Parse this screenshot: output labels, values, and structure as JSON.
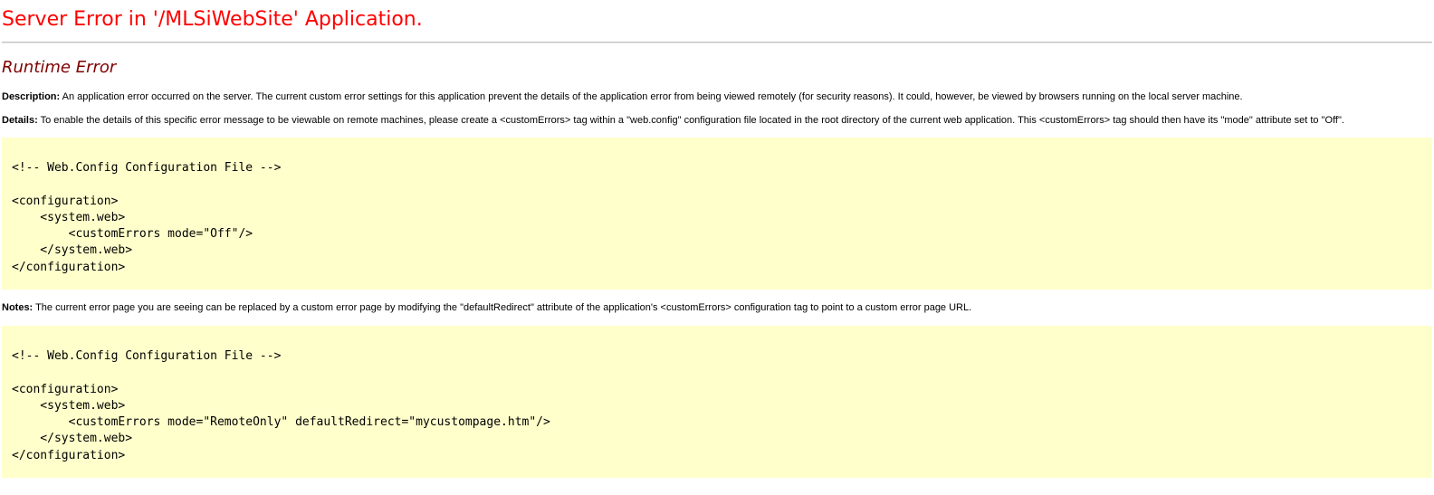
{
  "title": "Server Error in '/MLSiWebSite' Application.",
  "subtitle": "Runtime Error",
  "description": {
    "label": "Description:",
    "text": " An application error occurred on the server. The current custom error settings for this application prevent the details of the application error from being viewed remotely (for security reasons). It could, however, be viewed by browsers running on the local server machine."
  },
  "details": {
    "label": "Details:",
    "text": " To enable the details of this specific error message to be viewable on remote machines, please create a <customErrors> tag within a \"web.config\" configuration file located in the root directory of the current web application. This <customErrors> tag should then have its \"mode\" attribute set to \"Off\"."
  },
  "code1": "<!-- Web.Config Configuration File -->\n\n<configuration>\n    <system.web>\n        <customErrors mode=\"Off\"/>\n    </system.web>\n</configuration>",
  "notes": {
    "label": "Notes:",
    "text": " The current error page you are seeing can be replaced by a custom error page by modifying the \"defaultRedirect\" attribute of the application's <customErrors> configuration tag to point to a custom error page URL."
  },
  "code2": "<!-- Web.Config Configuration File -->\n\n<configuration>\n    <system.web>\n        <customErrors mode=\"RemoteOnly\" defaultRedirect=\"mycustompage.htm\"/>\n    </system.web>\n</configuration>",
  "colors": {
    "title": "#ff0000",
    "subtitle": "#800000",
    "code_background": "#ffffcc"
  }
}
